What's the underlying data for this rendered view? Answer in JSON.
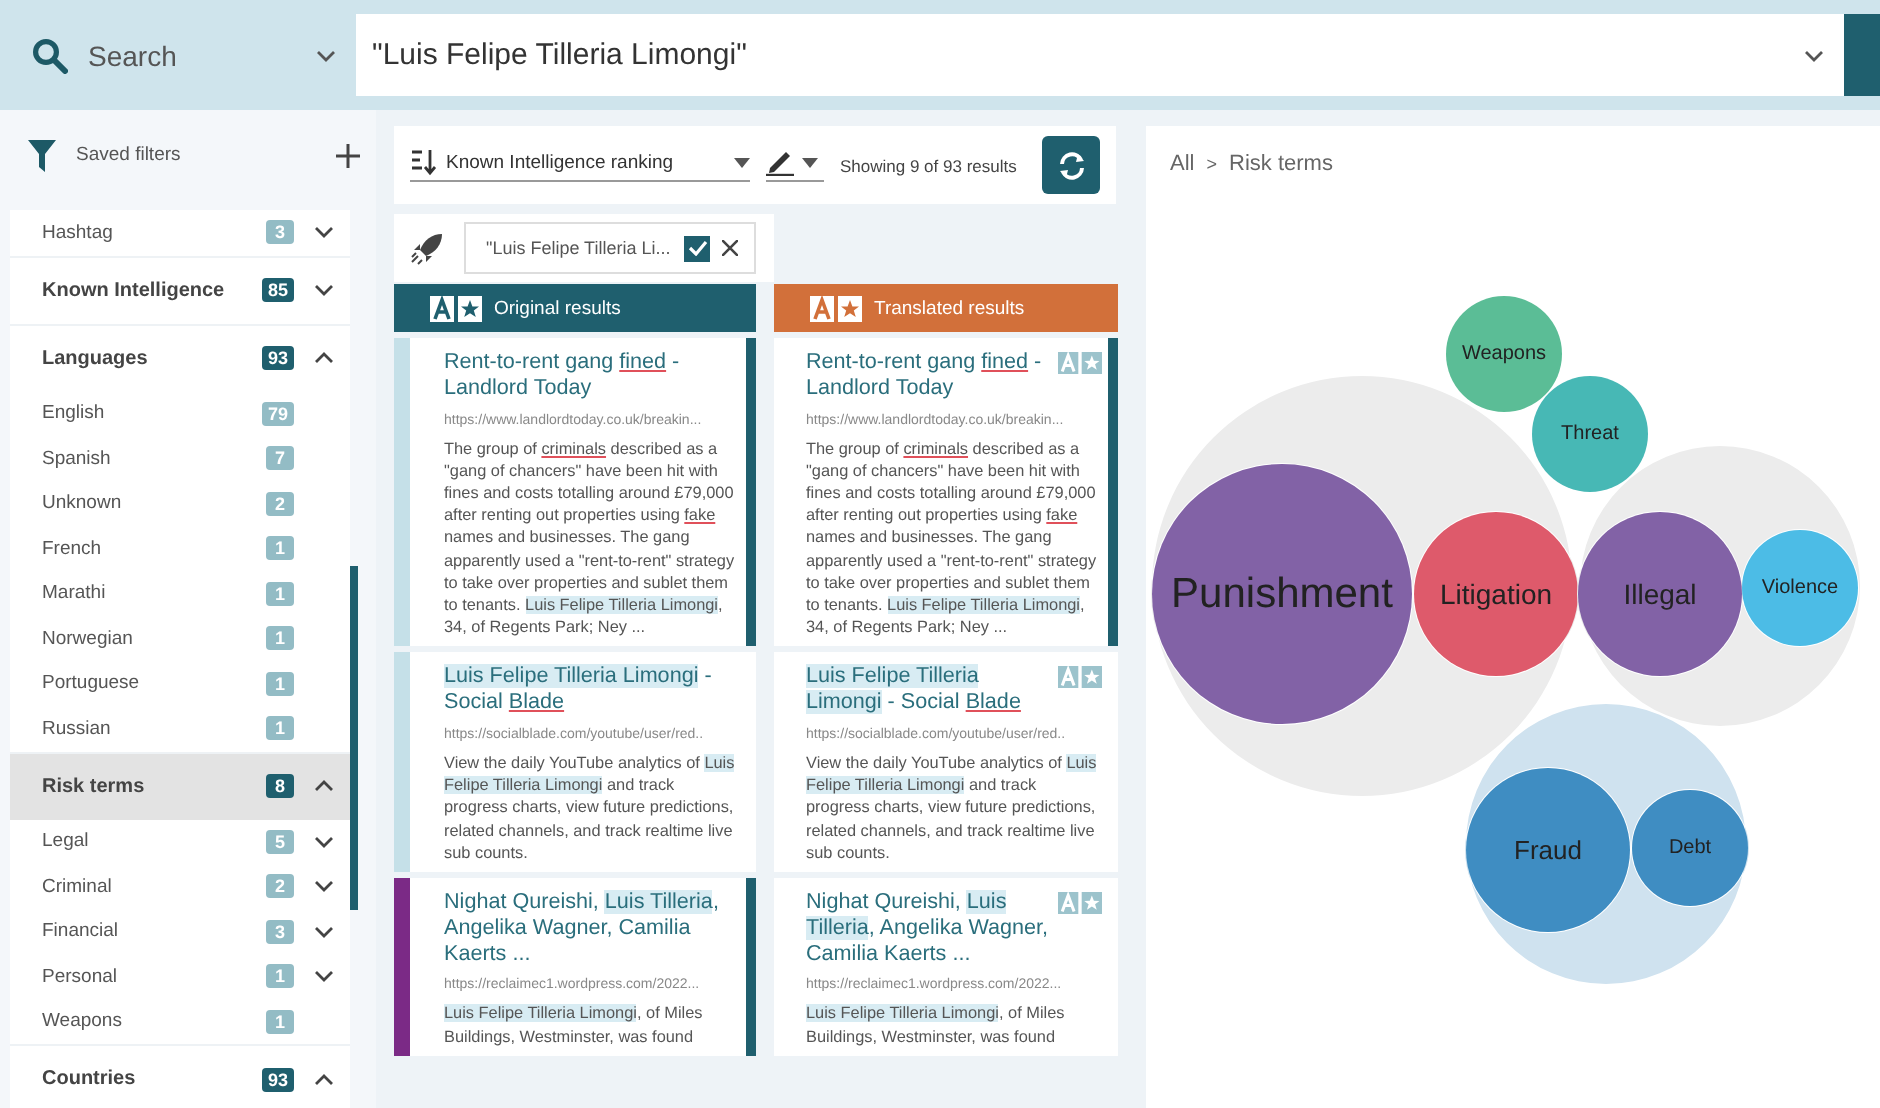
{
  "search_bar": {
    "scope": "Search",
    "query": "\"Luis Felipe Tilleria Limongi\""
  },
  "sidebar": {
    "saved_filters": "Saved filters",
    "facets": [
      {
        "label": "Hashtag",
        "count": "3",
        "kind": "subgroup",
        "expanded": false
      },
      {
        "label": "Known Intelligence",
        "count": "85",
        "kind": "group",
        "expanded": false,
        "selected": false
      },
      {
        "label": "Languages",
        "count": "93",
        "kind": "group",
        "expanded": true,
        "selected": false,
        "children": [
          {
            "label": "English",
            "count": "79",
            "kind": "leaf"
          },
          {
            "label": "Spanish",
            "count": "7",
            "kind": "leaf"
          },
          {
            "label": "Unknown",
            "count": "2",
            "kind": "leaf"
          },
          {
            "label": "French",
            "count": "1",
            "kind": "leaf"
          },
          {
            "label": "Marathi",
            "count": "1",
            "kind": "leaf"
          },
          {
            "label": "Norwegian",
            "count": "1",
            "kind": "leaf"
          },
          {
            "label": "Portuguese",
            "count": "1",
            "kind": "leaf"
          },
          {
            "label": "Russian",
            "count": "1",
            "kind": "leaf"
          }
        ]
      },
      {
        "label": "Risk terms",
        "count": "8",
        "kind": "group",
        "expanded": true,
        "selected": true,
        "children": [
          {
            "label": "Legal",
            "count": "5",
            "kind": "subgroup",
            "expanded": false
          },
          {
            "label": "Criminal",
            "count": "2",
            "kind": "subgroup",
            "expanded": false
          },
          {
            "label": "Financial",
            "count": "3",
            "kind": "subgroup",
            "expanded": false
          },
          {
            "label": "Personal",
            "count": "1",
            "kind": "subgroup",
            "expanded": false
          },
          {
            "label": "Weapons",
            "count": "1",
            "kind": "leaf"
          }
        ]
      },
      {
        "label": "Countries",
        "count": "93",
        "kind": "group",
        "expanded": true,
        "selected": false
      }
    ]
  },
  "toolbar": {
    "sort": "Known Intelligence ranking",
    "summary": "Showing 9 of 93 results"
  },
  "query_chip": {
    "text": "\"Luis Felipe Tilleria Li...",
    "checked": true
  },
  "results": [
    {
      "header": "Original results",
      "kind": "original",
      "color": "#1f5f6e",
      "cards": [
        {
          "color": "#c5e0e8",
          "selected": true,
          "title": [
            {
              "text": "Rent-to-rent gang ",
              "kind": "plain"
            },
            {
              "text": "fined",
              "kind": "term"
            },
            {
              "text": " - Landlord Today",
              "kind": "plain"
            }
          ],
          "url": "https://www.landlordtoday.co.uk/breakin...",
          "snippet": [
            {
              "text": "The group of ",
              "kind": "plain"
            },
            {
              "text": "criminals",
              "kind": "term"
            },
            {
              "text": " described as a \"gang of chancers\" have been hit with fines and costs totalling around £79,000 after renting out properties using ",
              "kind": "plain"
            },
            {
              "text": "fake",
              "kind": "term"
            },
            {
              "text": " names and businesses. The gang apparently used a \"rent-to-rent\" strategy to take over properties and sublet them to tenants. ",
              "kind": "plain"
            },
            {
              "text": "Luis Felipe Tilleria Limongi",
              "kind": "name"
            },
            {
              "text": ", 34, of Regents Park; Ney ...",
              "kind": "plain"
            }
          ]
        },
        {
          "color": "#c5e0e8",
          "selected": false,
          "title": [
            {
              "text": "Luis Felipe Tilleria Limongi",
              "kind": "name"
            },
            {
              "text": " - Social ",
              "kind": "plain"
            },
            {
              "text": "Blade",
              "kind": "term"
            }
          ],
          "url": "https://socialblade.com/youtube/user/red..",
          "snippet": [
            {
              "text": "View the daily YouTube analytics of ",
              "kind": "plain"
            },
            {
              "text": "Luis Felipe Tilleria Limongi",
              "kind": "name"
            },
            {
              "text": " and track progress charts, view future predictions, related channels, and track realtime live sub counts.",
              "kind": "plain"
            }
          ]
        },
        {
          "color": "#7b2a86",
          "selected": true,
          "title": [
            {
              "text": "Nighat Qureishi, ",
              "kind": "plain"
            },
            {
              "text": "Luis Tilleria",
              "kind": "name"
            },
            {
              "text": ", Angelika Wagner, Camilia Kaerts ...",
              "kind": "plain"
            }
          ],
          "url": "https://reclaimec1.wordpress.com/2022...",
          "snippet": [
            {
              "text": "Luis Felipe Tilleria Limongi",
              "kind": "name"
            },
            {
              "text": ", of Miles Buildings, Westminster, was found",
              "kind": "plain"
            }
          ]
        }
      ]
    },
    {
      "header": "Translated results",
      "kind": "translated",
      "color": "#d2703a",
      "cards": [
        {
          "selected": true,
          "title": [
            {
              "text": "Rent-to-rent gang ",
              "kind": "plain"
            },
            {
              "text": "fined",
              "kind": "term"
            },
            {
              "text": " - Landlord Today",
              "kind": "plain"
            }
          ],
          "url": "https://www.landlordtoday.co.uk/breakin...",
          "snippet": [
            {
              "text": "The group of ",
              "kind": "plain"
            },
            {
              "text": "criminals",
              "kind": "term"
            },
            {
              "text": " described as a \"gang of chancers\" have been hit with fines and costs totalling around £79,000 after renting out properties using ",
              "kind": "plain"
            },
            {
              "text": "fake",
              "kind": "term"
            },
            {
              "text": " names and businesses. The gang apparently used a \"rent-to-rent\" strategy to take over properties and sublet them to tenants. ",
              "kind": "plain"
            },
            {
              "text": "Luis Felipe Tilleria Limongi",
              "kind": "name"
            },
            {
              "text": ", 34, of Regents Park; Ney ...",
              "kind": "plain"
            }
          ]
        },
        {
          "selected": false,
          "title": [
            {
              "text": "Luis Felipe Tilleria Limongi",
              "kind": "name"
            },
            {
              "text": " - Social ",
              "kind": "plain"
            },
            {
              "text": "Blade",
              "kind": "term"
            }
          ],
          "url": "https://socialblade.com/youtube/user/red..",
          "snippet": [
            {
              "text": "View the daily YouTube analytics of ",
              "kind": "plain"
            },
            {
              "text": "Luis Felipe Tilleria Limongi",
              "kind": "name"
            },
            {
              "text": " and track progress charts, view future predictions, related channels, and track realtime live sub counts.",
              "kind": "plain"
            }
          ]
        },
        {
          "selected": false,
          "title": [
            {
              "text": "Nighat Qureishi, ",
              "kind": "plain"
            },
            {
              "text": "Luis Tilleria",
              "kind": "name"
            },
            {
              "text": ", Angelika Wagner, Camilia Kaerts ...",
              "kind": "plain"
            }
          ],
          "url": "https://reclaimec1.wordpress.com/2022...",
          "snippet": [
            {
              "text": "Luis Felipe Tilleria Limongi",
              "kind": "name"
            },
            {
              "text": ", of Miles Buildings, Westminster, was found",
              "kind": "plain"
            }
          ]
        }
      ]
    }
  ],
  "bubble_chart": {
    "breadcrumb": [
      {
        "label": "All"
      },
      {
        "label": "Risk terms"
      }
    ],
    "separator": ">",
    "bubbles": [
      {
        "kind": "bubble",
        "label": "Weapons",
        "color": "#5bbd96"
      },
      {
        "kind": "bubble",
        "label": "Threat",
        "color": "#47b8b5"
      },
      {
        "kind": "cluster",
        "color": "#ececec",
        "children": [
          {
            "label": "Punishment",
            "color": "#8262a6"
          },
          {
            "label": "Litigation",
            "color": "#de5a6b"
          }
        ]
      },
      {
        "kind": "cluster",
        "color": "#ececec",
        "children": [
          {
            "label": "Illegal",
            "color": "#8262a6"
          },
          {
            "label": "Violence",
            "color": "#4cbce6"
          }
        ]
      },
      {
        "kind": "cluster",
        "color": "#cfe2ef",
        "children": [
          {
            "label": "Fraud",
            "color": "#3f8dc2"
          },
          {
            "label": "Debt",
            "color": "#3f8dc2"
          }
        ]
      }
    ]
  }
}
